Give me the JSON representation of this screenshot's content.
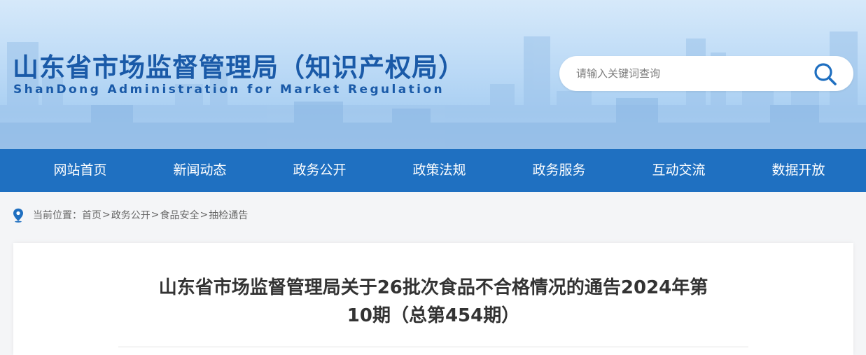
{
  "header": {
    "title": "山东省市场监督管理局（知识产权局）",
    "subtitle": "ShanDong Administration for Market Regulation",
    "search": {
      "placeholder": "请输入关键词查询",
      "icon": "search-icon"
    }
  },
  "nav": {
    "items": [
      {
        "label": "网站首页"
      },
      {
        "label": "新闻动态"
      },
      {
        "label": "政务公开"
      },
      {
        "label": "政策法规"
      },
      {
        "label": "政务服务"
      },
      {
        "label": "互动交流"
      },
      {
        "label": "数据开放"
      }
    ]
  },
  "breadcrumb": {
    "icon": "location-pin-icon",
    "prefix": "当前位置：",
    "items": [
      "首页",
      "政务公开",
      "食品安全",
      "抽检通告"
    ],
    "separator": ">"
  },
  "article": {
    "title_line1": "山东省市场监督管理局关于26批次食品不合格情况的通告2024年第",
    "title_line2": "10期（总第454期）"
  },
  "colors": {
    "brand_blue": "#1a5aa8",
    "nav_blue": "#1f70c1",
    "title_text": "#333333"
  }
}
